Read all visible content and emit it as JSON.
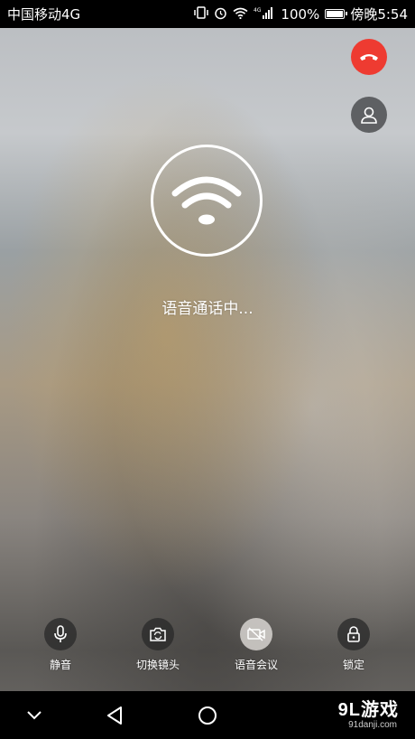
{
  "status_bar": {
    "carrier": "中国移动4G",
    "network": "4G",
    "battery_percent": "100%",
    "time": "傍晚5:54",
    "battery_level": 1.0
  },
  "call": {
    "status_text": "语音通话中...",
    "hangup_icon": "phone-hangup-icon",
    "hangup_color": "#ee3b31",
    "contact_icon": "contact-icon",
    "center_icon": "wifi-icon"
  },
  "controls": [
    {
      "label": "静音",
      "icon": "microphone-icon"
    },
    {
      "label": "切换镜头",
      "icon": "camera-switch-icon"
    },
    {
      "label": "语音会议",
      "icon": "video-off-icon"
    },
    {
      "label": "锁定",
      "icon": "lock-icon"
    }
  ],
  "nav": {
    "watermark_main": "9L游戏",
    "watermark_sub": "91danji.com"
  }
}
